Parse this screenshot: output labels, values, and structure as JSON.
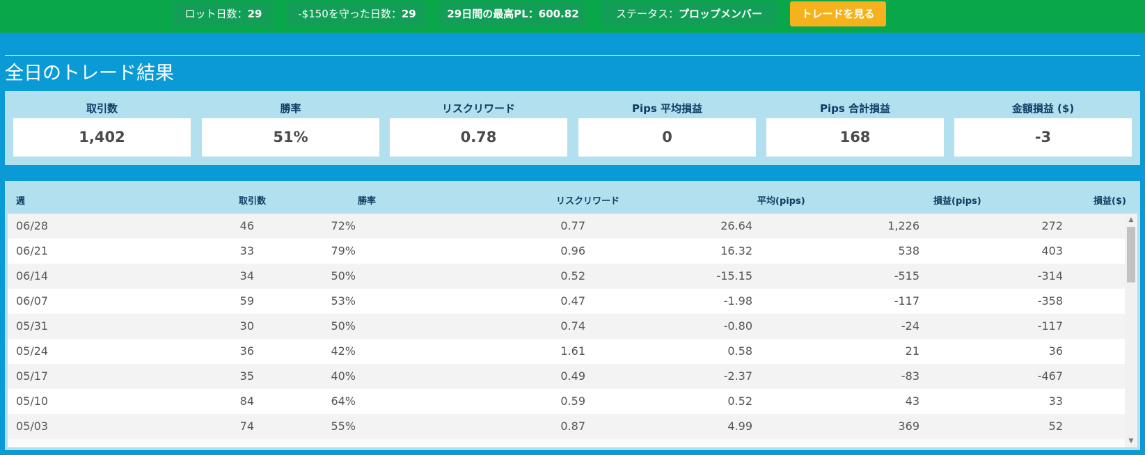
{
  "topbar": {
    "lot_days_label": "ロット日数：",
    "lot_days_value": "29",
    "protected_days_label": "-$150を守った日数：",
    "protected_days_value": "29",
    "max_pl_label": "29日間の最高PL：",
    "max_pl_value": "600.82",
    "status_label": "ステータス：",
    "status_value": "プロップメンバー",
    "view_trades_button": "トレードを見る"
  },
  "section_title": "全日のトレード結果",
  "stats": [
    {
      "label": "取引数",
      "value": "1,402"
    },
    {
      "label": "勝率",
      "value": "51%"
    },
    {
      "label": "リスクリワード",
      "value": "0.78"
    },
    {
      "label": "Pips 平均損益",
      "value": "0"
    },
    {
      "label": "Pips 合計損益",
      "value": "168"
    },
    {
      "label": "金額損益 ($)",
      "value": "-3"
    }
  ],
  "table": {
    "headers": {
      "week": "週",
      "trades": "取引数",
      "win_rate": "勝率",
      "risk_reward": "リスクリワード",
      "avg_pips": "平均(pips)",
      "pl_pips": "損益(pips)",
      "pl_usd": "損益($)"
    },
    "rows": [
      {
        "week": "06/28",
        "trades": "46",
        "win_rate": "72%",
        "risk_reward": "0.77",
        "avg_pips": "26.64",
        "pl_pips": "1,226",
        "pl_usd": "272"
      },
      {
        "week": "06/21",
        "trades": "33",
        "win_rate": "79%",
        "risk_reward": "0.96",
        "avg_pips": "16.32",
        "pl_pips": "538",
        "pl_usd": "403"
      },
      {
        "week": "06/14",
        "trades": "34",
        "win_rate": "50%",
        "risk_reward": "0.52",
        "avg_pips": "-15.15",
        "pl_pips": "-515",
        "pl_usd": "-314"
      },
      {
        "week": "06/07",
        "trades": "59",
        "win_rate": "53%",
        "risk_reward": "0.47",
        "avg_pips": "-1.98",
        "pl_pips": "-117",
        "pl_usd": "-358"
      },
      {
        "week": "05/31",
        "trades": "30",
        "win_rate": "50%",
        "risk_reward": "0.74",
        "avg_pips": "-0.80",
        "pl_pips": "-24",
        "pl_usd": "-117"
      },
      {
        "week": "05/24",
        "trades": "36",
        "win_rate": "42%",
        "risk_reward": "1.61",
        "avg_pips": "0.58",
        "pl_pips": "21",
        "pl_usd": "36"
      },
      {
        "week": "05/17",
        "trades": "35",
        "win_rate": "40%",
        "risk_reward": "0.49",
        "avg_pips": "-2.37",
        "pl_pips": "-83",
        "pl_usd": "-467"
      },
      {
        "week": "05/10",
        "trades": "84",
        "win_rate": "64%",
        "risk_reward": "0.59",
        "avg_pips": "0.52",
        "pl_pips": "43",
        "pl_usd": "33"
      },
      {
        "week": "05/03",
        "trades": "74",
        "win_rate": "55%",
        "risk_reward": "0.87",
        "avg_pips": "4.99",
        "pl_pips": "369",
        "pl_usd": "52"
      }
    ]
  },
  "colors": {
    "topbar_bg": "#0aa64a",
    "page_bg": "#0a9bd6",
    "panel_bg": "#b3e0ef",
    "cta_bg": "#f6b21d",
    "header_text": "#0e3d63"
  },
  "icons": {
    "scroll_up": "scroll-up-arrow-icon",
    "scroll_down": "scroll-down-arrow-icon"
  }
}
